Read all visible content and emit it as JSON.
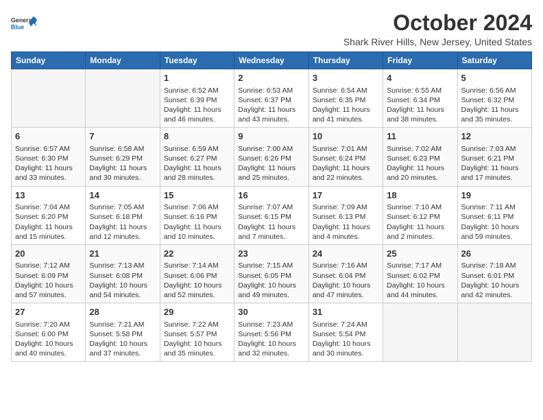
{
  "logo": {
    "line1": "General",
    "line2": "Blue"
  },
  "title": "October 2024",
  "location": "Shark River Hills, New Jersey, United States",
  "weekdays": [
    "Sunday",
    "Monday",
    "Tuesday",
    "Wednesday",
    "Thursday",
    "Friday",
    "Saturday"
  ],
  "weeks": [
    [
      {
        "day": "",
        "info": ""
      },
      {
        "day": "",
        "info": ""
      },
      {
        "day": "1",
        "info": "Sunrise: 6:52 AM\nSunset: 6:39 PM\nDaylight: 11 hours\nand 46 minutes."
      },
      {
        "day": "2",
        "info": "Sunrise: 6:53 AM\nSunset: 6:37 PM\nDaylight: 11 hours\nand 43 minutes."
      },
      {
        "day": "3",
        "info": "Sunrise: 6:54 AM\nSunset: 6:35 PM\nDaylight: 11 hours\nand 41 minutes."
      },
      {
        "day": "4",
        "info": "Sunrise: 6:55 AM\nSunset: 6:34 PM\nDaylight: 11 hours\nand 38 minutes."
      },
      {
        "day": "5",
        "info": "Sunrise: 6:56 AM\nSunset: 6:32 PM\nDaylight: 11 hours\nand 35 minutes."
      }
    ],
    [
      {
        "day": "6",
        "info": "Sunrise: 6:57 AM\nSunset: 6:30 PM\nDaylight: 11 hours\nand 33 minutes."
      },
      {
        "day": "7",
        "info": "Sunrise: 6:58 AM\nSunset: 6:29 PM\nDaylight: 11 hours\nand 30 minutes."
      },
      {
        "day": "8",
        "info": "Sunrise: 6:59 AM\nSunset: 6:27 PM\nDaylight: 11 hours\nand 28 minutes."
      },
      {
        "day": "9",
        "info": "Sunrise: 7:00 AM\nSunset: 6:26 PM\nDaylight: 11 hours\nand 25 minutes."
      },
      {
        "day": "10",
        "info": "Sunrise: 7:01 AM\nSunset: 6:24 PM\nDaylight: 11 hours\nand 22 minutes."
      },
      {
        "day": "11",
        "info": "Sunrise: 7:02 AM\nSunset: 6:23 PM\nDaylight: 11 hours\nand 20 minutes."
      },
      {
        "day": "12",
        "info": "Sunrise: 7:03 AM\nSunset: 6:21 PM\nDaylight: 11 hours\nand 17 minutes."
      }
    ],
    [
      {
        "day": "13",
        "info": "Sunrise: 7:04 AM\nSunset: 6:20 PM\nDaylight: 11 hours\nand 15 minutes."
      },
      {
        "day": "14",
        "info": "Sunrise: 7:05 AM\nSunset: 6:18 PM\nDaylight: 11 hours\nand 12 minutes."
      },
      {
        "day": "15",
        "info": "Sunrise: 7:06 AM\nSunset: 6:16 PM\nDaylight: 11 hours\nand 10 minutes."
      },
      {
        "day": "16",
        "info": "Sunrise: 7:07 AM\nSunset: 6:15 PM\nDaylight: 11 hours\nand 7 minutes."
      },
      {
        "day": "17",
        "info": "Sunrise: 7:09 AM\nSunset: 6:13 PM\nDaylight: 11 hours\nand 4 minutes."
      },
      {
        "day": "18",
        "info": "Sunrise: 7:10 AM\nSunset: 6:12 PM\nDaylight: 11 hours\nand 2 minutes."
      },
      {
        "day": "19",
        "info": "Sunrise: 7:11 AM\nSunset: 6:11 PM\nDaylight: 10 hours\nand 59 minutes."
      }
    ],
    [
      {
        "day": "20",
        "info": "Sunrise: 7:12 AM\nSunset: 6:09 PM\nDaylight: 10 hours\nand 57 minutes."
      },
      {
        "day": "21",
        "info": "Sunrise: 7:13 AM\nSunset: 6:08 PM\nDaylight: 10 hours\nand 54 minutes."
      },
      {
        "day": "22",
        "info": "Sunrise: 7:14 AM\nSunset: 6:06 PM\nDaylight: 10 hours\nand 52 minutes."
      },
      {
        "day": "23",
        "info": "Sunrise: 7:15 AM\nSunset: 6:05 PM\nDaylight: 10 hours\nand 49 minutes."
      },
      {
        "day": "24",
        "info": "Sunrise: 7:16 AM\nSunset: 6:04 PM\nDaylight: 10 hours\nand 47 minutes."
      },
      {
        "day": "25",
        "info": "Sunrise: 7:17 AM\nSunset: 6:02 PM\nDaylight: 10 hours\nand 44 minutes."
      },
      {
        "day": "26",
        "info": "Sunrise: 7:18 AM\nSunset: 6:01 PM\nDaylight: 10 hours\nand 42 minutes."
      }
    ],
    [
      {
        "day": "27",
        "info": "Sunrise: 7:20 AM\nSunset: 6:00 PM\nDaylight: 10 hours\nand 40 minutes."
      },
      {
        "day": "28",
        "info": "Sunrise: 7:21 AM\nSunset: 5:58 PM\nDaylight: 10 hours\nand 37 minutes."
      },
      {
        "day": "29",
        "info": "Sunrise: 7:22 AM\nSunset: 5:57 PM\nDaylight: 10 hours\nand 35 minutes."
      },
      {
        "day": "30",
        "info": "Sunrise: 7:23 AM\nSunset: 5:56 PM\nDaylight: 10 hours\nand 32 minutes."
      },
      {
        "day": "31",
        "info": "Sunrise: 7:24 AM\nSunset: 5:54 PM\nDaylight: 10 hours\nand 30 minutes."
      },
      {
        "day": "",
        "info": ""
      },
      {
        "day": "",
        "info": ""
      }
    ]
  ]
}
